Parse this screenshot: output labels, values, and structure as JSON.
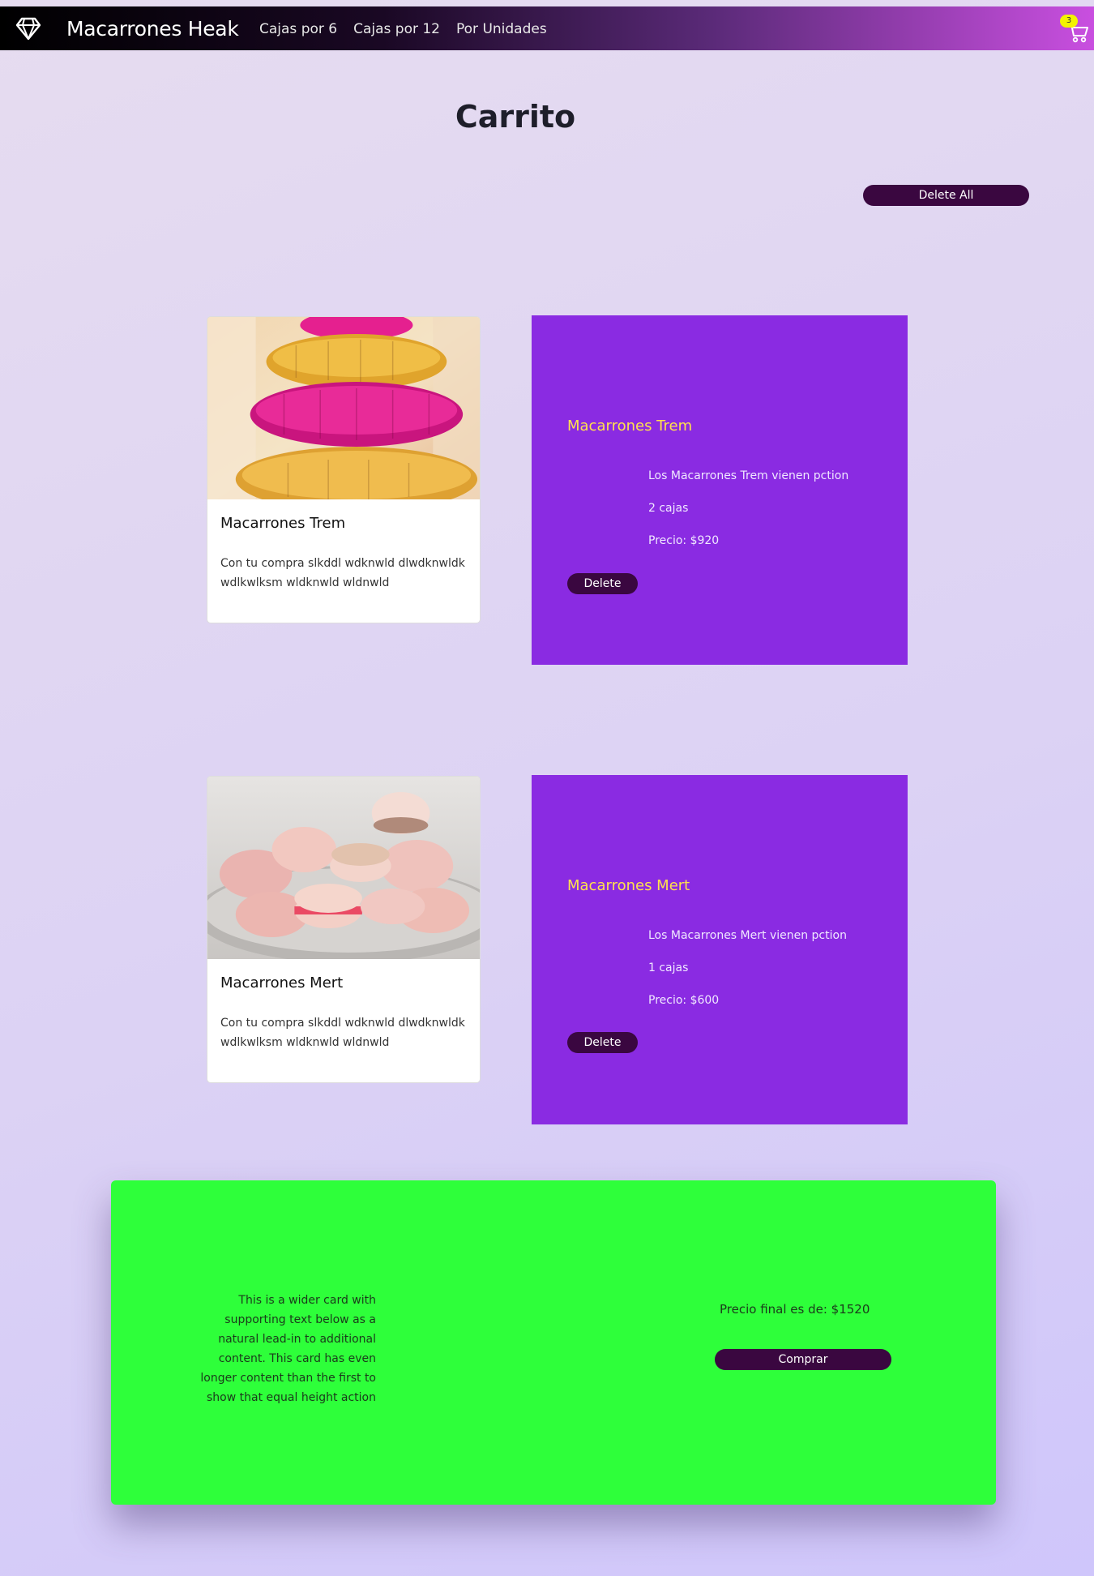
{
  "navbar": {
    "brand": "Macarrones Heak",
    "links": [
      "Cajas por 6",
      "Cajas por 12",
      "Por Unidades"
    ],
    "cart_count": "3"
  },
  "page": {
    "title": "Carrito",
    "delete_all_label": "Delete All"
  },
  "items": [
    {
      "card_title": "Macarrones Trem",
      "card_desc": "Con tu compra slkddl wdknwld dlwdknwldk wdlkwlksm wldknwld wldnwld",
      "detail_title": "Macarrones Trem",
      "detail_desc": "Los Macarrones Trem vienen pction",
      "quantity": "2 cajas",
      "price": "Precio: $920",
      "delete_label": "Delete"
    },
    {
      "card_title": "Macarrones Mert",
      "card_desc": "Con tu compra slkddl wdknwld dlwdknwldk wdlkwlksm wldknwld wldnwld",
      "detail_title": "Macarrones Mert",
      "detail_desc": "Los Macarrones Mert vienen pction",
      "quantity": "1 cajas",
      "price": "Precio: $600",
      "delete_label": "Delete"
    }
  ],
  "summary": {
    "text": "This is a wider card with supporting text below as a natural lead-in to additional content. This card has even longer content than the first to show that equal height action",
    "final_price": "Precio final es de: $1520",
    "buy_label": "Comprar"
  },
  "colors": {
    "detail_panel": "#8a2be2",
    "detail_title": "#ffe14d",
    "button": "#3a0740",
    "summary_card": "#2eff3a",
    "badge": "#f3f300"
  }
}
